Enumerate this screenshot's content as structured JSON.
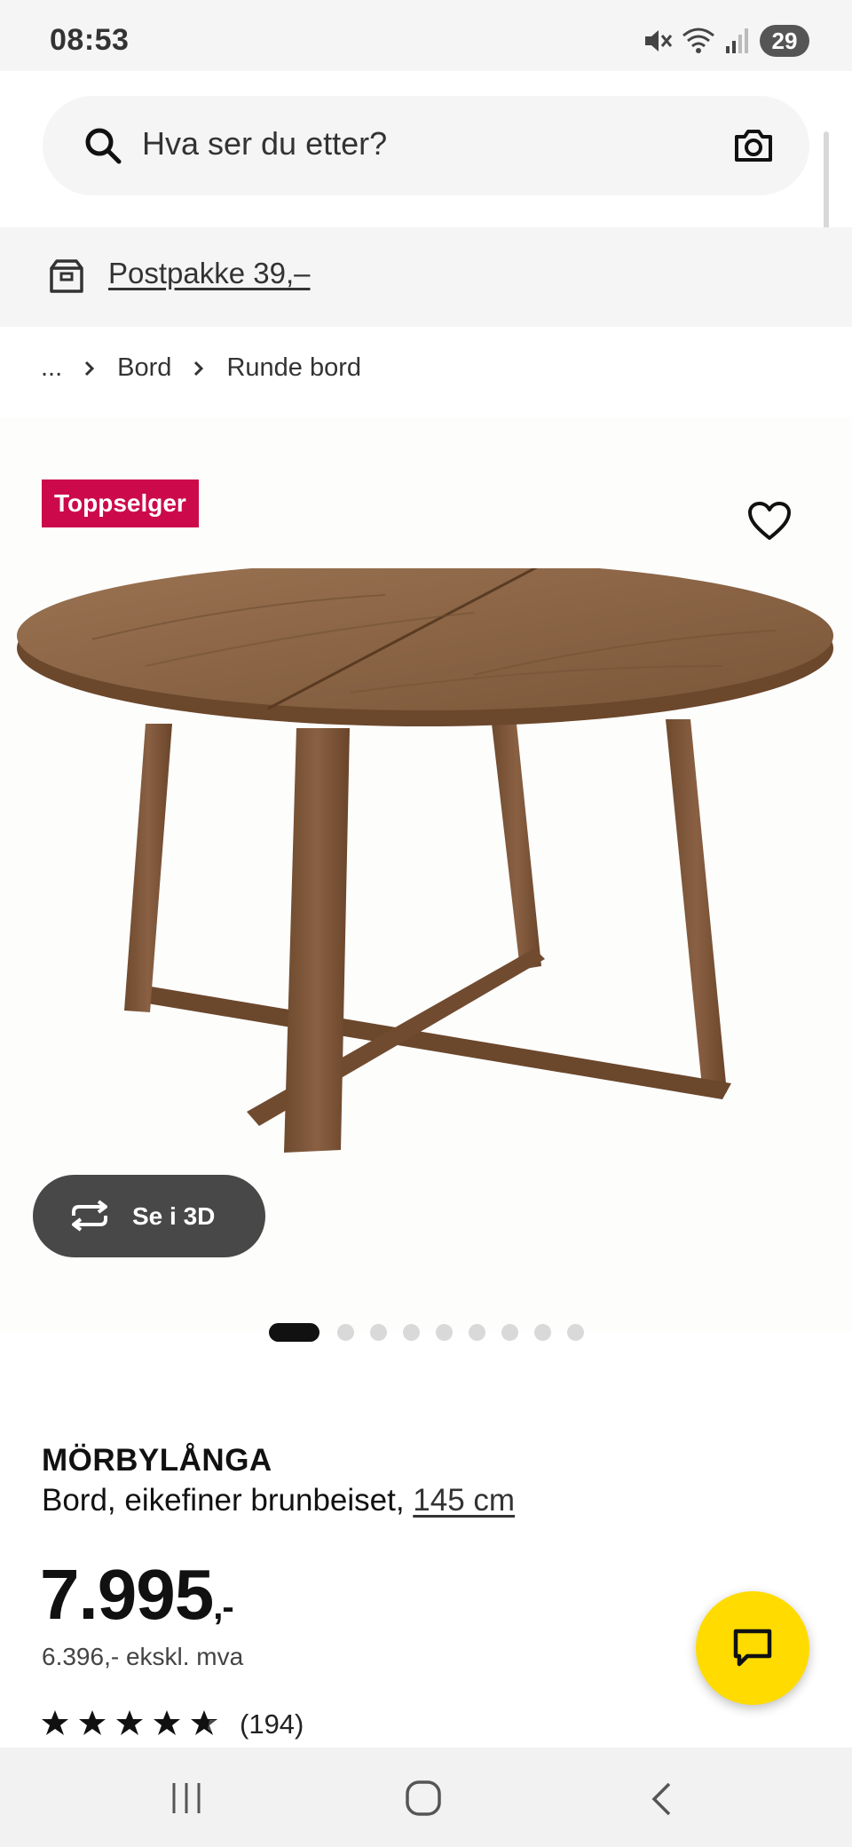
{
  "status_bar": {
    "time": "08:53",
    "battery": "29",
    "icons": [
      "mute-icon",
      "wifi-icon",
      "signal-icon"
    ]
  },
  "search": {
    "placeholder": "Hva ser du etter?",
    "icon": "search-icon",
    "camera_icon": "camera-icon"
  },
  "promo": {
    "text": "Postpakke 39,–",
    "icon": "parcel-icon"
  },
  "breadcrumb": {
    "ellipsis": "...",
    "items": [
      "Bord",
      "Runde bord"
    ]
  },
  "product": {
    "badge": "Toppselger",
    "name": "MÖRBYLÅNGA",
    "description": "Bord, eikefiner brunbeiset, ",
    "size": "145 cm",
    "price": "7.995",
    "price_suffix": ",-",
    "price_ex_vat": "6.396,- ekskl. mva",
    "rating": 5,
    "rating_count": "(194)",
    "image_count": 9,
    "active_image": 0
  },
  "buttons": {
    "view_3d": "Se i 3D"
  },
  "colors": {
    "badge": "#cc0a4b",
    "chat_button": "#ffdb00",
    "button_3d": "#484848",
    "background_gray": "#f5f5f5"
  }
}
